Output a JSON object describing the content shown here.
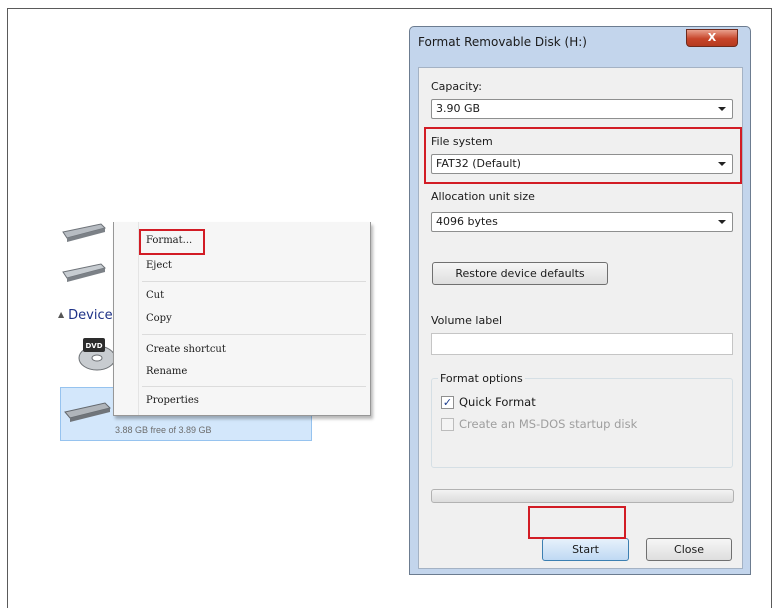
{
  "context_menu": {
    "items": [
      {
        "label": "Format..."
      },
      {
        "label": "Eject"
      },
      {
        "label": "Cut"
      },
      {
        "label": "Copy"
      },
      {
        "label": "Create shortcut"
      },
      {
        "label": "Rename"
      },
      {
        "label": "Properties"
      }
    ]
  },
  "explorer": {
    "devices_label": "Device",
    "selected_drive_free": "3.88 GB free of 3.89 GB",
    "dvd_icon_text": "DVD"
  },
  "dialog": {
    "title": "Format Removable Disk (H:)",
    "close_glyph": "X",
    "capacity_label": "Capacity:",
    "capacity_value": "3.90 GB",
    "file_system_label": "File system",
    "file_system_value": "FAT32 (Default)",
    "allocation_label": "Allocation unit size",
    "allocation_value": "4096 bytes",
    "restore_button": "Restore device defaults",
    "volume_label": "Volume label",
    "volume_value": "",
    "format_options_label": "Format options",
    "quick_format_label": "Quick Format",
    "quick_format_checked": true,
    "msdos_label": "Create an MS-DOS startup disk",
    "msdos_checked": false,
    "progress_percent": 0,
    "start_button": "Start",
    "close_button": "Close"
  },
  "colors": {
    "highlight": "#d21c25",
    "dialog_frame": "#c3d5ec",
    "selection": "#d3e7fb"
  }
}
